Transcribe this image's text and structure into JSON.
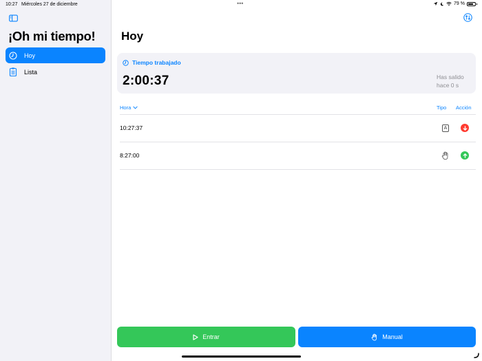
{
  "status_bar": {
    "time": "10:27",
    "date": "Miércoles 27 de diciembre",
    "multitask_dots": "•••",
    "battery_percent": "79 %",
    "battery_level": 0.79
  },
  "sidebar": {
    "app_title": "¡Oh mi tiempo!",
    "items": [
      {
        "label": "Hoy",
        "icon": "clock-icon",
        "active": true
      },
      {
        "label": "Lista",
        "icon": "clipboard-list-icon",
        "active": false
      }
    ]
  },
  "main": {
    "title": "Hoy",
    "summary": {
      "label": "Tiempo trabajado",
      "value": "2:00:37",
      "status_line1": "Has salido",
      "status_line2": "hace 0 s"
    },
    "table": {
      "headers": {
        "hora": "Hora",
        "tipo": "Tipo",
        "accion": "Acción"
      },
      "rows": [
        {
          "time": "10:27:37",
          "type": "automatic",
          "type_icon": "auto-badge-icon",
          "type_glyph": "A",
          "action": "salida",
          "action_icon": "arrow-down-circle-icon",
          "action_color": "#ff3b30"
        },
        {
          "time": "8:27:00",
          "type": "manual",
          "type_icon": "hand-icon",
          "action": "entrada",
          "action_icon": "arrow-up-circle-icon",
          "action_color": "#34c759"
        }
      ]
    },
    "buttons": {
      "entrar": "Entrar",
      "manual": "Manual"
    }
  },
  "colors": {
    "accent": "#0a84ff",
    "green": "#34c759",
    "red": "#ff3b30",
    "sidebar_bg": "#f2f2f7"
  }
}
